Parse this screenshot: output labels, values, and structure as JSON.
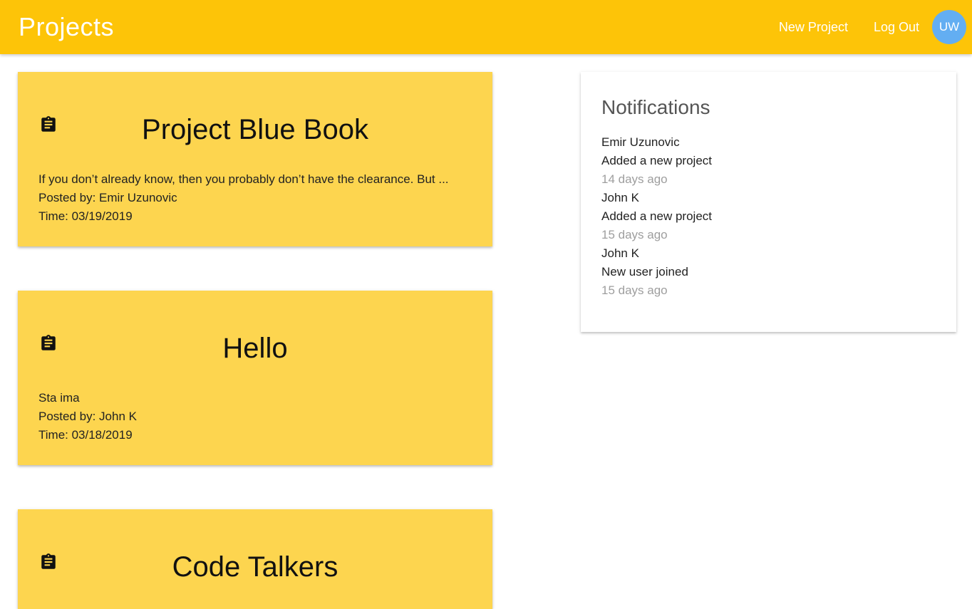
{
  "navbar": {
    "brand": "Projects",
    "links": [
      "New Project",
      "Log Out"
    ],
    "avatar_initials": "UW",
    "accent_color": "#fdc408",
    "avatar_color": "#63aef2"
  },
  "projects": [
    {
      "icon": "clipboard-icon",
      "title": "Project Blue Book",
      "summary": "If you don’t already know, then you probably don’t have the clearance. But ...",
      "posted_by": "Posted by: Emir Uzunovic",
      "time": "Time: 03/19/2019"
    },
    {
      "icon": "clipboard-icon",
      "title": "Hello",
      "summary": "Sta ima",
      "posted_by": "Posted by: John K",
      "time": "Time: 03/18/2019"
    },
    {
      "icon": "clipboard-icon",
      "title": "Code Talkers"
    }
  ],
  "notifications": {
    "title": "Notifications",
    "items": [
      {
        "user": "Emir Uzunovic",
        "action": "Added a new project",
        "when": "14 days ago"
      },
      {
        "user": "John K",
        "action": "Added a new project",
        "when": "15 days ago"
      },
      {
        "user": "John K",
        "action": "New user joined",
        "when": "15 days ago"
      }
    ]
  }
}
